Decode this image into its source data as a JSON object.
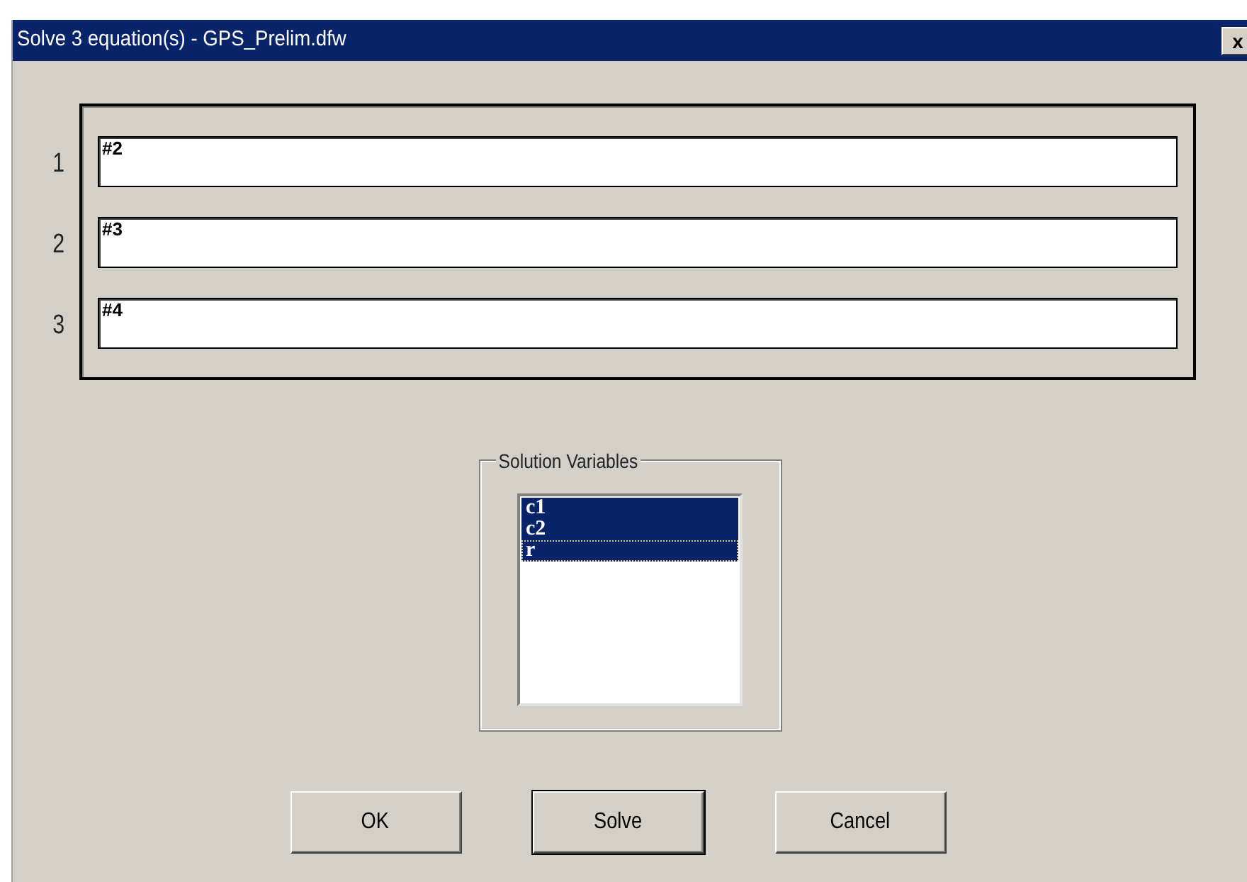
{
  "window": {
    "title": "Solve 3 equation(s) - GPS_Prelim.dfw",
    "close": "x"
  },
  "equations": [
    {
      "number": "1",
      "value": "#2"
    },
    {
      "number": "2",
      "value": "#3"
    },
    {
      "number": "3",
      "value": "#4"
    }
  ],
  "solution_variables": {
    "label": "Solution Variables",
    "items": [
      {
        "label": "c1",
        "selected": true,
        "focused": false
      },
      {
        "label": "c2",
        "selected": true,
        "focused": false
      },
      {
        "label": "r",
        "selected": true,
        "focused": true
      }
    ]
  },
  "buttons": [
    {
      "label": "OK",
      "default": false
    },
    {
      "label": "Solve",
      "default": true
    },
    {
      "label": "Cancel",
      "default": false
    }
  ]
}
